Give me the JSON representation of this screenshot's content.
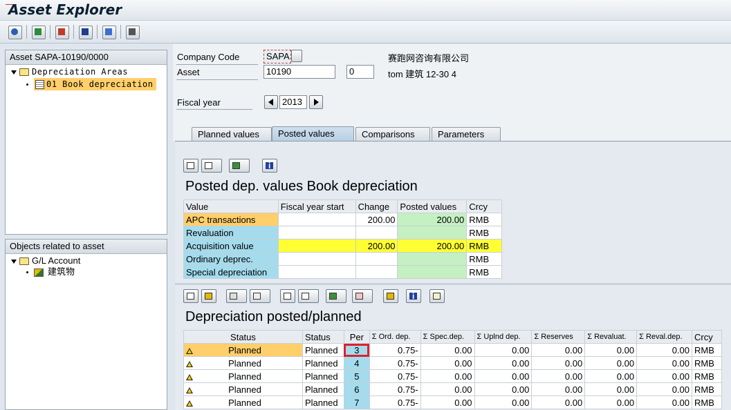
{
  "window": {
    "title": "Asset Explorer"
  },
  "toolbar": {
    "icons": [
      "refresh-icon",
      "save-icon",
      "display-icon",
      "hierarchy-icon",
      "objects-icon",
      "list-icon"
    ]
  },
  "tree_assets": {
    "header": "Asset SAPA-10190/0000",
    "root": "Depreciation Areas",
    "child": "01 Book depreciation"
  },
  "tree_objects": {
    "header": "Objects related to asset",
    "root": "G/L Account",
    "child": "建筑物"
  },
  "form": {
    "company_code_label": "Company Code",
    "company_code_value": "SAPA",
    "company_name": "赛跑网咨询有限公司",
    "asset_label": "Asset",
    "asset_value": "10190",
    "asset_sub": "0",
    "asset_desc": "tom 建筑 12-30 4",
    "fiscal_year_label": "Fiscal year",
    "fiscal_year_value": "2013"
  },
  "tabs": [
    {
      "label": "Planned values",
      "active": false
    },
    {
      "label": "Posted values",
      "active": true
    },
    {
      "label": "Comparisons",
      "active": false
    },
    {
      "label": "Parameters",
      "active": false
    }
  ],
  "posted": {
    "title": "Posted dep. values Book depreciation",
    "headers": [
      "Value",
      "Fiscal year start",
      "Change",
      "Posted values",
      "Crcy"
    ],
    "rows": [
      [
        "APC transactions",
        "",
        "200.00",
        "200.00",
        "RMB"
      ],
      [
        "Revaluation",
        "",
        "",
        "",
        "RMB"
      ],
      [
        "Acquisition value",
        "",
        "200.00",
        "200.00",
        "RMB"
      ],
      [
        "Ordinary deprec.",
        "",
        "",
        "",
        "RMB"
      ],
      [
        "Special depreciation",
        "",
        "",
        "",
        "RMB"
      ]
    ]
  },
  "planned": {
    "title": "Depreciation posted/planned",
    "headers": [
      "Status",
      "Status",
      "Per",
      "Σ Ord. dep.",
      "Σ Spec.dep.",
      "Σ Uplnd dep.",
      "Σ Reserves",
      "Σ Revaluat.",
      "Σ Reval.dep.",
      "Crcy"
    ],
    "rows": [
      [
        "Planned",
        "Planned",
        "3",
        "0.75-",
        "0.00",
        "0.00",
        "0.00",
        "0.00",
        "0.00",
        "RMB"
      ],
      [
        "Planned",
        "Planned",
        "4",
        "0.75-",
        "0.00",
        "0.00",
        "0.00",
        "0.00",
        "0.00",
        "RMB"
      ],
      [
        "Planned",
        "Planned",
        "5",
        "0.75-",
        "0.00",
        "0.00",
        "0.00",
        "0.00",
        "0.00",
        "RMB"
      ],
      [
        "Planned",
        "Planned",
        "6",
        "0.75-",
        "0.00",
        "0.00",
        "0.00",
        "0.00",
        "0.00",
        "RMB"
      ],
      [
        "Planned",
        "Planned",
        "7",
        "0.75-",
        "0.00",
        "0.00",
        "0.00",
        "0.00",
        "0.00",
        "RMB"
      ]
    ]
  }
}
